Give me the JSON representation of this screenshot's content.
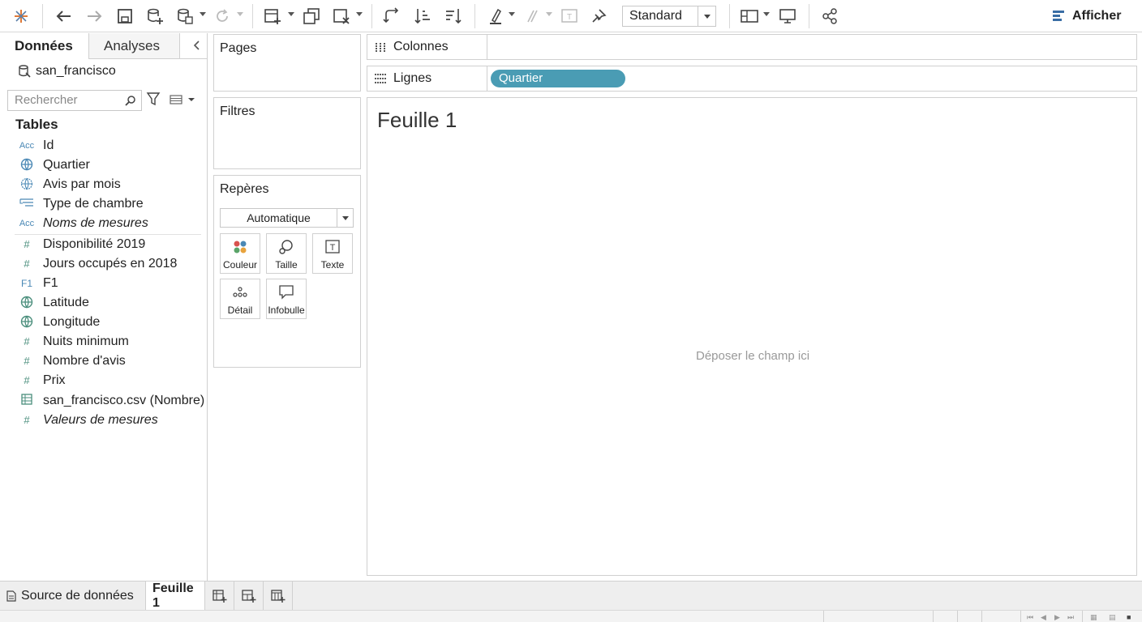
{
  "toolbar": {
    "icons": [
      "tableau-logo-icon",
      "undo-icon",
      "redo-icon",
      "save-icon",
      "new-datasource-icon",
      "pause-updates-icon",
      "refresh-icon",
      "new-sheet-icon",
      "duplicate-sheet-icon",
      "clear-sheet-icon",
      "swap-icon",
      "sort-ascending-icon",
      "sort-descending-icon",
      "highlight-icon",
      "group-icon",
      "labels-icon",
      "pin-icon",
      "show-cards-icon",
      "presentation-icon",
      "share-icon"
    ],
    "fit_select": "Standard",
    "show_me_label": "Afficher"
  },
  "data_pane": {
    "tabs": [
      "Données",
      "Analyses"
    ],
    "datasource": "san_francisco",
    "search_placeholder": "Rechercher",
    "tables_heading": "Tables",
    "dimensions": [
      {
        "icon": "Acc",
        "label": "Id"
      },
      {
        "icon": "geo",
        "label": "Quartier"
      },
      {
        "icon": "geo-dim",
        "label": "Avis par mois"
      },
      {
        "icon": "hierarchy",
        "label": "Type de chambre"
      },
      {
        "icon": "Acc",
        "label": "Noms de mesures"
      }
    ],
    "measures": [
      {
        "icon": "#",
        "label": "Disponibilité 2019"
      },
      {
        "icon": "#",
        "label": "Jours occupés en 2018"
      },
      {
        "icon": "F1",
        "label": "F1"
      },
      {
        "icon": "globe",
        "label": "Latitude"
      },
      {
        "icon": "globe",
        "label": "Longitude"
      },
      {
        "icon": "#",
        "label": "Nuits minimum"
      },
      {
        "icon": "#",
        "label": "Nombre d'avis"
      },
      {
        "icon": "#",
        "label": "Prix"
      },
      {
        "icon": "table",
        "label": "san_francisco.csv (Nombre)"
      },
      {
        "icon": "#",
        "label": "Valeurs de mesures"
      }
    ]
  },
  "cards": {
    "pages": "Pages",
    "filters": "Filtres",
    "marks": "Repères",
    "mark_type": "Automatique",
    "mark_buttons": [
      "Couleur",
      "Taille",
      "Texte",
      "Détail",
      "Infobulle"
    ]
  },
  "shelves": {
    "columns_label": "Colonnes",
    "rows_label": "Lignes",
    "rows_pill": "Quartier"
  },
  "view": {
    "sheet_title": "Feuille 1",
    "drop_hint": "Déposer le champ ici"
  },
  "bottom": {
    "source_tab": "Source de données",
    "sheet_tab": "Feuille 1"
  }
}
